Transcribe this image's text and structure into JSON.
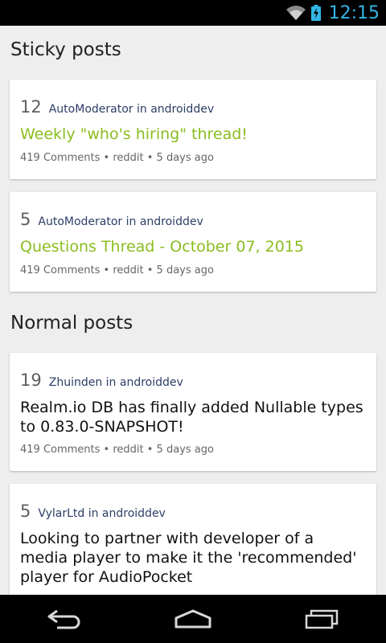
{
  "status_bar": {
    "time": "12:15",
    "icons": [
      "wifi-icon",
      "battery-charging-icon"
    ],
    "accent_color": "#33b5e5"
  },
  "sections": {
    "sticky_title": "Sticky posts",
    "normal_title": "Normal posts"
  },
  "sticky_posts": [
    {
      "score": "12",
      "byline": "AutoModerator in androiddev",
      "title": "Weekly \"who's hiring\" thread!",
      "footer": "419 Comments • reddit • 5 days ago"
    },
    {
      "score": "5",
      "byline": "AutoModerator in androiddev",
      "title": "Questions Thread - October 07, 2015",
      "footer": "419 Comments • reddit • 5 days ago"
    }
  ],
  "normal_posts": [
    {
      "score": "19",
      "byline": "Zhuinden in androiddev",
      "title": "Realm.io DB has finally added Nullable types to 0.83.0-SNAPSHOT!",
      "footer": "419 Comments • reddit • 5 days ago"
    },
    {
      "score": "5",
      "byline": "VylarLtd in androiddev",
      "title": "Looking to partner with developer of a media player to make it the 'recommended' player for AudioPocket"
    }
  ],
  "colors": {
    "sticky_title": "#8bbd1f",
    "byline": "#2c3e66"
  },
  "nav_bar": {
    "icons": [
      "back-icon",
      "home-icon",
      "recent-apps-icon"
    ]
  }
}
